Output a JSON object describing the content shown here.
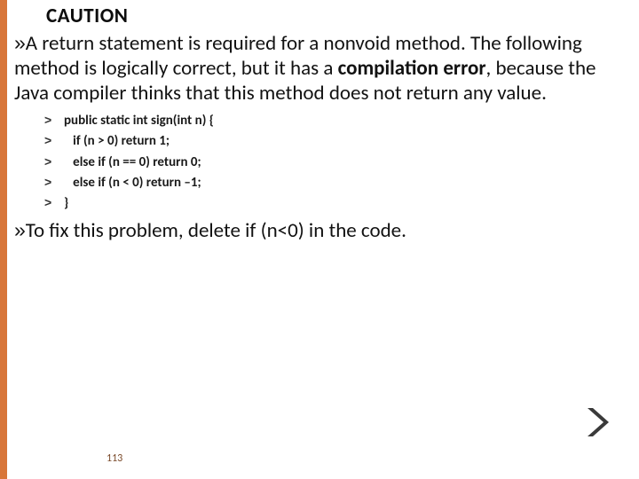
{
  "title": "CAUTION",
  "para1": {
    "bullet": "»",
    "pre": "A return statement is required for a nonvoid method. The following method is logically correct, but it has a ",
    "strong": "compilation error",
    "post": ", because the Java compiler thinks that this method does not return any value."
  },
  "code": {
    "bullet": "˃",
    "lines": [
      "public static int sign(int n) {",
      "   if (n > 0) return 1;",
      "   else if (n == 0) return 0;",
      "   else if (n < 0) return –1;",
      "}"
    ]
  },
  "para2": {
    "bullet": "»",
    "text": "To fix this problem, delete if (n<0) in the code."
  },
  "page_number": "113"
}
